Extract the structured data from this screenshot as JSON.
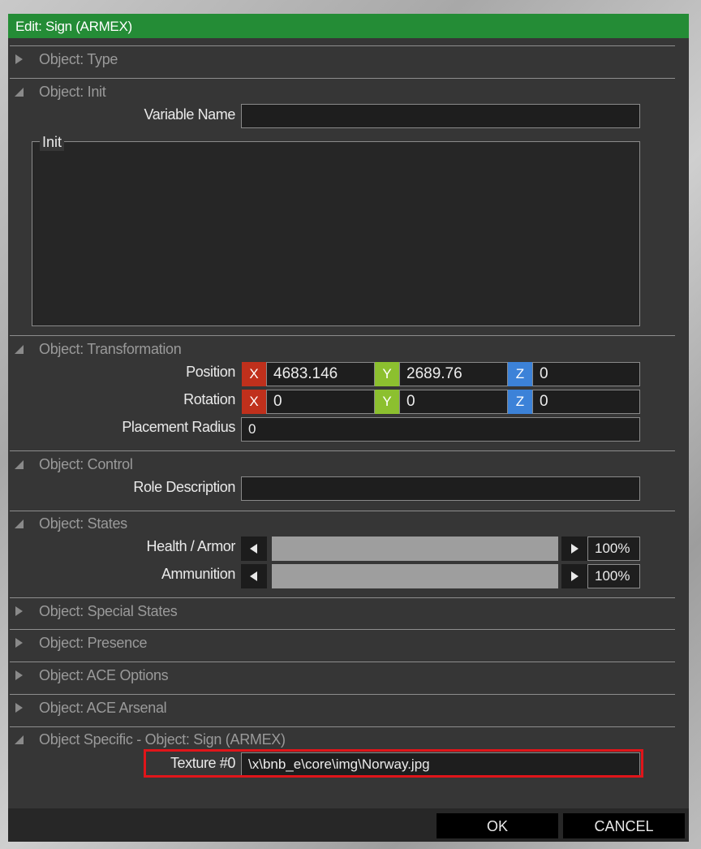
{
  "window": {
    "title": "Edit: Sign (ARMEX)"
  },
  "sections": {
    "type": "Object: Type",
    "init": "Object: Init",
    "transformation": "Object: Transformation",
    "control": "Object: Control",
    "states": "Object: States",
    "special_states": "Object: Special States",
    "presence": "Object: Presence",
    "ace_options": "Object: ACE Options",
    "ace_arsenal": "Object: ACE Arsenal",
    "specific": "Object Specific - Object: Sign (ARMEX)"
  },
  "init": {
    "variable_name_label": "Variable Name",
    "variable_name_value": "",
    "init_label": "Init",
    "init_value": ""
  },
  "transformation": {
    "position_label": "Position",
    "rotation_label": "Rotation",
    "placement_radius_label": "Placement Radius",
    "axis_x": "X",
    "axis_y": "Y",
    "axis_z": "Z",
    "position": {
      "x": "4683.146",
      "y": "2689.76",
      "z": "0"
    },
    "rotation": {
      "x": "0",
      "y": "0",
      "z": "0"
    },
    "placement_radius": "0"
  },
  "control": {
    "role_description_label": "Role Description",
    "role_description_value": ""
  },
  "states": {
    "health_label": "Health / Armor",
    "health_value": "100%",
    "health_level": 1.0,
    "ammo_label": "Ammunition",
    "ammo_value": "100%",
    "ammo_level": 1.0
  },
  "specific": {
    "texture_label": "Texture #0",
    "texture_value": "\\x\\bnb_e\\core\\img\\Norway.jpg"
  },
  "buttons": {
    "ok": "OK",
    "cancel": "CANCEL"
  },
  "colors": {
    "title_bar": "#248c36",
    "axis_x": "#c0301c",
    "axis_y": "#8cc02f",
    "axis_z": "#3c82d8",
    "highlight": "#e0151a"
  },
  "icons": {
    "collapsed": "triangle-right-icon",
    "expanded": "triangle-down-icon"
  }
}
